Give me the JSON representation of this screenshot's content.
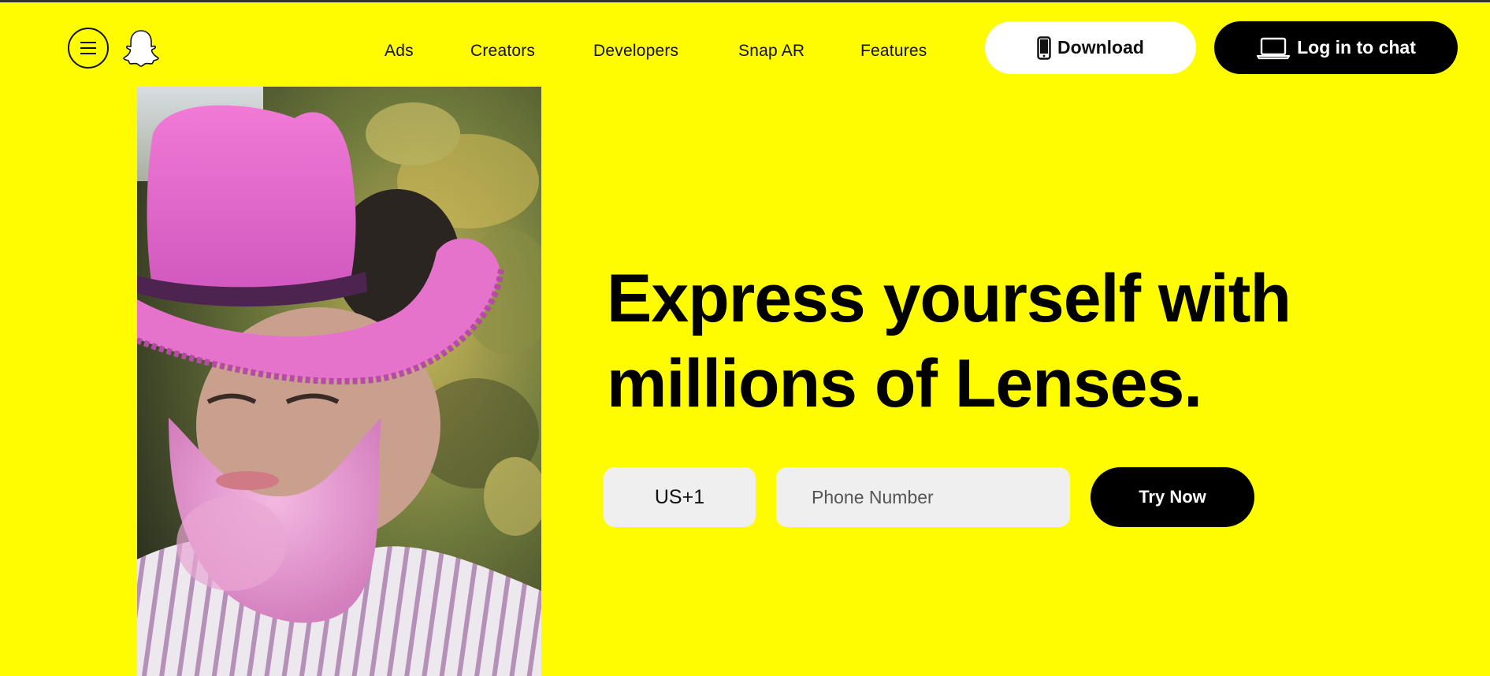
{
  "brand": {
    "accent": "#FFFC00",
    "logo_icon": "snapchat-ghost-icon",
    "menu_icon": "hamburger-menu-icon"
  },
  "nav": {
    "items": [
      {
        "label": "Ads"
      },
      {
        "label": "Creators"
      },
      {
        "label": "Developers"
      },
      {
        "label": "Snap AR"
      },
      {
        "label": "Features"
      }
    ]
  },
  "header": {
    "download_label": "Download",
    "download_icon": "smartphone-icon",
    "login_label": "Log in to chat",
    "login_icon": "laptop-icon"
  },
  "hero": {
    "headline_line1": "Express yourself with",
    "headline_line2": "millions of Lenses.",
    "image_description_icon": "lens-preview-image"
  },
  "form": {
    "country_code": "US+1",
    "phone_placeholder": "Phone Number",
    "phone_value": "",
    "submit_label": "Try Now"
  }
}
